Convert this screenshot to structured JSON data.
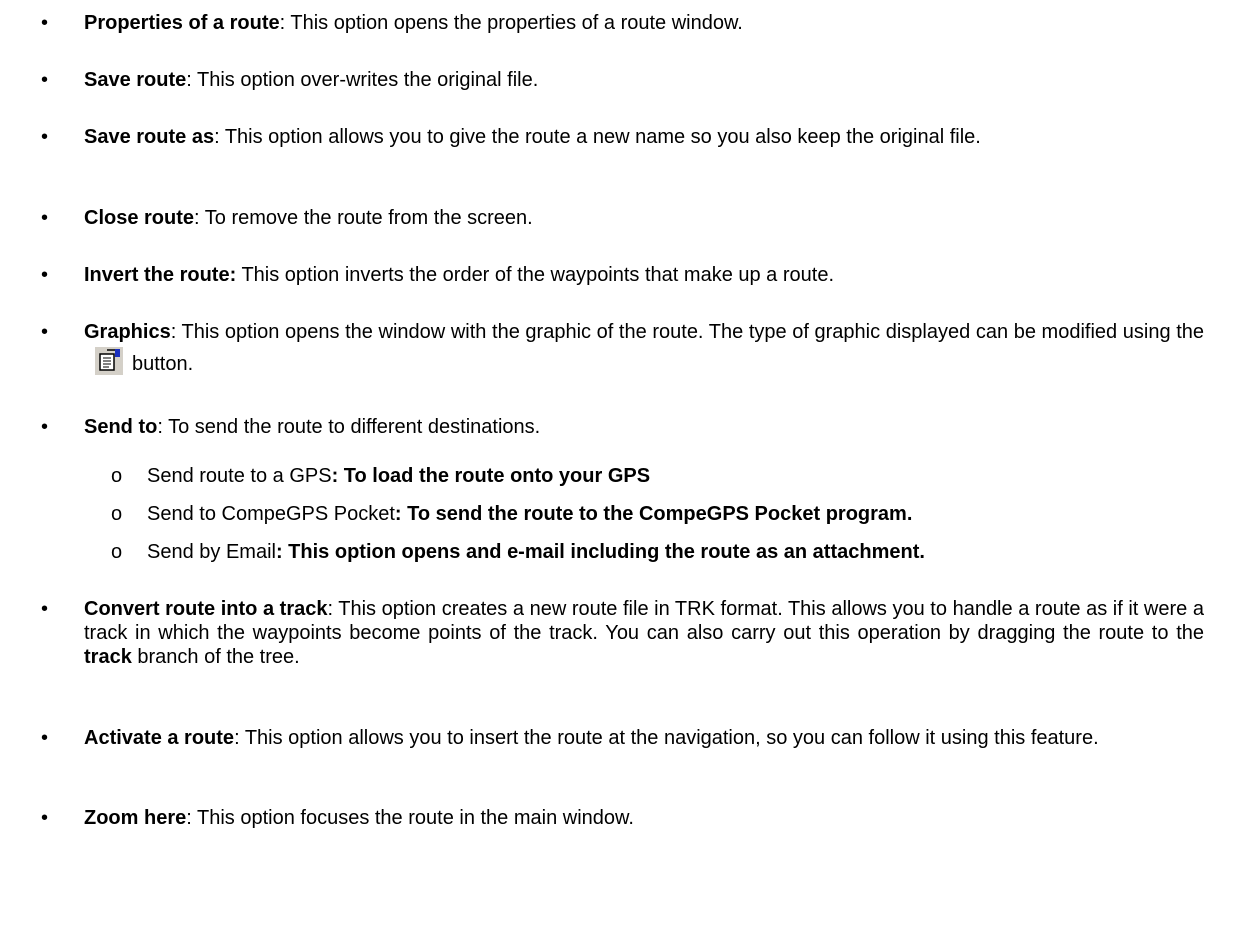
{
  "items": [
    {
      "term": "Properties of a route",
      "sep": ":",
      "desc": " This option opens the properties of a route window."
    },
    {
      "term": "Save route",
      "sep": ":",
      "desc": " This option over-writes the original file."
    },
    {
      "term": "Save route as",
      "sep": ":",
      "desc": " This option allows you to give the route a new name so you also keep the original file."
    },
    {
      "term": "Close route",
      "sep": ":",
      "desc": " To remove the route from the screen."
    },
    {
      "term": "Invert the route:",
      "sep": "",
      "desc": " This option inverts the order of the waypoints that make up a route."
    },
    {
      "term": "Graphics",
      "sep": ":",
      "desc": " This option opens the window with the graphic of the route. The type of graphic displayed can be modified using the",
      "after_icon": "button."
    },
    {
      "term": "Send to",
      "sep": ":",
      "desc": " To send the route to different destinations."
    },
    {
      "term": "Convert route into a track",
      "sep": ":",
      "desc": " This option creates a new route file in TRK format. This allows you to handle a route as if it were a track in which the waypoints become points of the track. You can also carry out this operation by dragging the route to the ",
      "bold_word": "track",
      "desc_end": " branch of the tree."
    },
    {
      "term": "Activate a route",
      "sep": ":",
      "desc": " This option allows you to insert the route at the navigation, so you can follow it using this feature."
    },
    {
      "term": "Zoom here",
      "sep": ":",
      "desc": " This option focuses the route in the main window."
    }
  ],
  "sub_items": [
    {
      "mark": "o",
      "plain": "Send route to a GPS",
      "bold": ": To load the route onto your GPS"
    },
    {
      "mark": "o",
      "plain": "Send to CompeGPS Pocket",
      "bold": ": To send the route to the CompeGPS Pocket program."
    },
    {
      "mark": "o",
      "plain": "Send by Email",
      "bold": ": This option opens and e-mail including the route as an attachment."
    }
  ],
  "bullet_glyph": "•",
  "icon": "properties-icon"
}
